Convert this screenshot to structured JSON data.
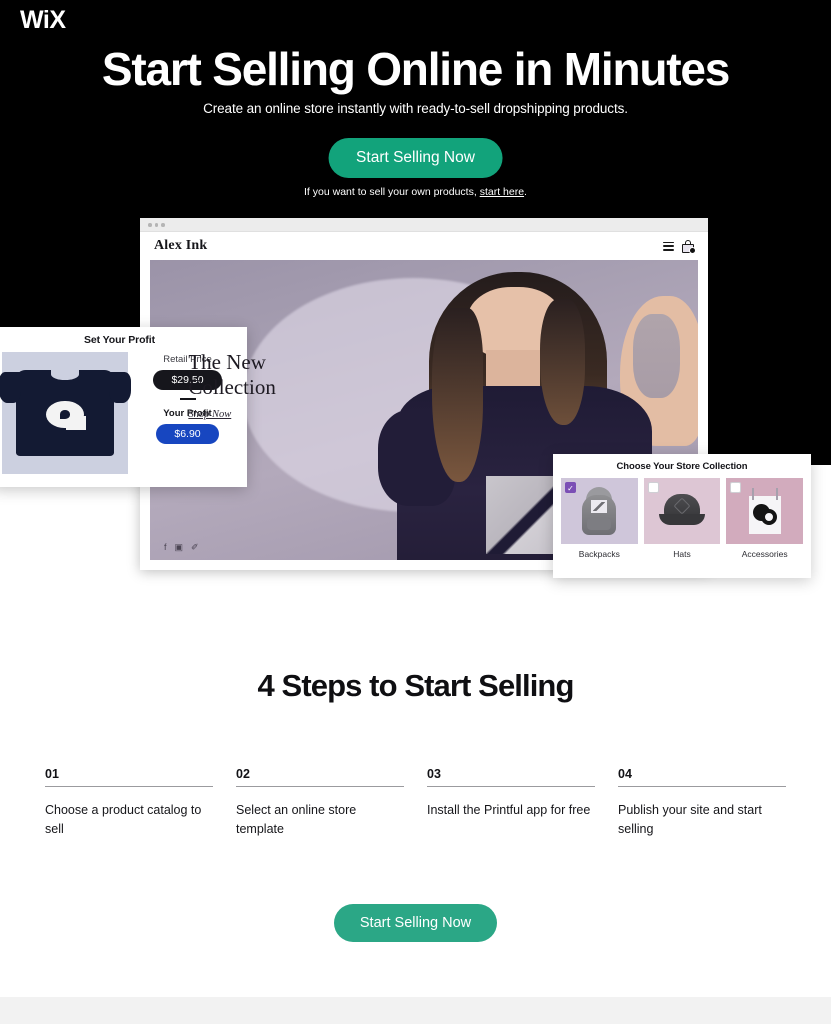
{
  "brand": {
    "logo_text": "WiX"
  },
  "hero": {
    "title": "Start Selling Online in Minutes",
    "subtitle": "Create an online store instantly with ready-to-sell dropshipping products.",
    "cta_label": "Start Selling Now",
    "note_prefix": "If you want to sell your own products, ",
    "note_link": "start here",
    "note_suffix": ".",
    "background_color": "#000000",
    "cta_color": "#12A37B"
  },
  "mockup": {
    "site_name": "Alex Ink",
    "menu_icon": "hamburger-icon",
    "cart_icon": "shopping-bag-icon",
    "hero_line1": "The New",
    "hero_line2": "Collection",
    "shop_link": "Shop Now",
    "social": [
      "f",
      "▣",
      "✐"
    ]
  },
  "profit_card": {
    "title": "Set Your Profit",
    "retail_label": "Retail Price",
    "retail_value": "$29.50",
    "profit_label": "Your Profit",
    "profit_value": "$6.90",
    "retail_pill_color": "#16161c",
    "profit_pill_color": "#1746c0"
  },
  "collection_card": {
    "title": "Choose Your Store Collection",
    "items": [
      {
        "label": "Backpacks",
        "checked": true,
        "check_glyph": "✓"
      },
      {
        "label": "Hats",
        "checked": false,
        "check_glyph": ""
      },
      {
        "label": "Accessories",
        "checked": false,
        "check_glyph": ""
      }
    ],
    "checked_color": "#7b4fb5"
  },
  "steps": {
    "title": "4 Steps to Start Selling",
    "items": [
      {
        "num": "01",
        "text": "Choose a product catalog to sell"
      },
      {
        "num": "02",
        "text": "Select an online store template"
      },
      {
        "num": "03",
        "text": "Install the Printful app for free"
      },
      {
        "num": "04",
        "text": "Publish your site and start selling"
      }
    ],
    "cta_label": "Start Selling Now",
    "cta_color": "#2BA786"
  }
}
